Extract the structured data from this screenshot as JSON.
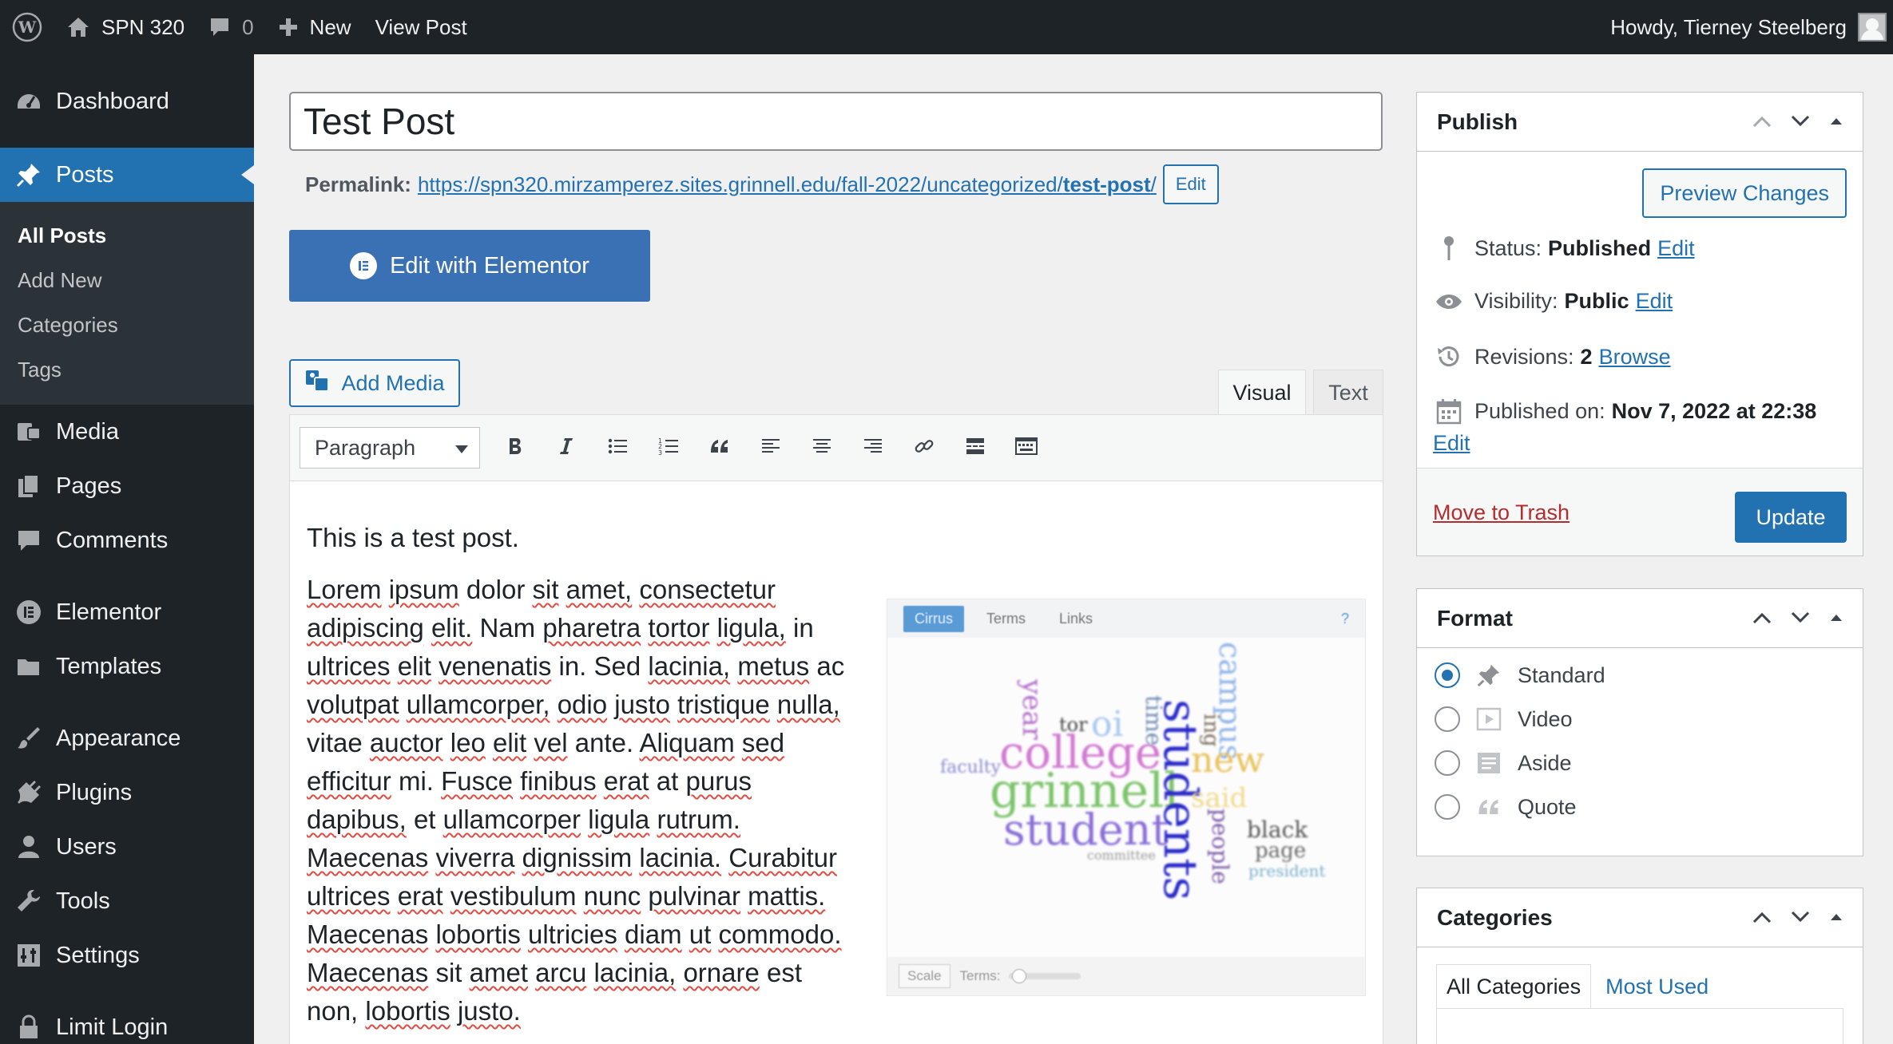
{
  "admin_bar": {
    "site_name": "SPN 320",
    "comments_count": "0",
    "new_label": "New",
    "view_post_label": "View Post",
    "howdy": "Howdy, Tierney Steelberg"
  },
  "sidebar": {
    "items": [
      {
        "label": "Dashboard",
        "icon": "dashboard-icon"
      },
      {
        "label": "Posts",
        "icon": "pin-icon"
      },
      {
        "label": "Media",
        "icon": "media-icon"
      },
      {
        "label": "Pages",
        "icon": "pages-icon"
      },
      {
        "label": "Comments",
        "icon": "comment-icon"
      },
      {
        "label": "Elementor",
        "icon": "elementor-icon"
      },
      {
        "label": "Templates",
        "icon": "folder-icon"
      },
      {
        "label": "Appearance",
        "icon": "brush-icon"
      },
      {
        "label": "Plugins",
        "icon": "plug-icon"
      },
      {
        "label": "Users",
        "icon": "user-icon"
      },
      {
        "label": "Tools",
        "icon": "wrench-icon"
      },
      {
        "label": "Settings",
        "icon": "settings-icon"
      },
      {
        "label": "Limit Login",
        "icon": "lock-icon"
      }
    ],
    "posts_submenu": [
      "All Posts",
      "Add New",
      "Categories",
      "Tags"
    ]
  },
  "editor": {
    "title": "Test Post",
    "permalink_label": "Permalink:",
    "permalink_base": "https://spn320.mirzamperez.sites.grinnell.edu/fall-2022/uncategorized/",
    "permalink_slug": "test-post",
    "permalink_trailing": "/",
    "permalink_edit": "Edit",
    "elementor_button": "Edit with Elementor",
    "add_media": "Add Media",
    "tab_visual": "Visual",
    "tab_text": "Text",
    "format_select": "Paragraph",
    "intro": "This is a test post.",
    "body": "Lorem ipsum dolor sit amet, consectetur adipiscing elit. Nam pharetra tortor ligula, in ultrices elit venenatis in. Sed lacinia, metus ac volutpat ullamcorper, odio justo tristique nulla, vitae auctor leo elit vel ante. Aliquam sed efficitur mi. Fusce finibus erat at purus dapibus, et ullamcorper ligula rutrum. Maecenas viverra dignissim lacinia. Curabitur ultrices erat vestibulum nunc pulvinar mattis. Maecenas lobortis ultricies diam ut commodo. Maecenas sit amet arcu lacinia, ornare est non, lobortis justo.",
    "spell_flagged": [
      "Lorem",
      "ipsum",
      "amet,",
      "consectetur",
      "adipiscing",
      "elit.",
      "pharetra",
      "tortor",
      "ligula,",
      "ultrices",
      "elit",
      "venenatis",
      "lacinia,",
      "metus",
      "volutpat",
      "ullamcorper,",
      "odio",
      "justo",
      "tristique",
      "nulla,",
      "auctor",
      "leo",
      "elit",
      "vel",
      "Aliquam",
      "sed",
      "efficitur",
      "Fusce",
      "finibus",
      "erat",
      "purus",
      "dapibus,",
      "ullamcorper",
      "ligula",
      "rutrum.",
      "Maecenas",
      "viverra",
      "dignissim",
      "lacinia.",
      "Curabitur",
      "ultrices",
      "erat",
      "vestibulum",
      "nunc",
      "pulvinar",
      "mattis.",
      "Maecenas",
      "lobortis",
      "ultricies",
      "diam",
      "ut",
      "commodo.",
      "Maecenas",
      "sit",
      "amet",
      "arcu",
      "lacinia,",
      "ornare",
      "lobortis",
      "justo."
    ]
  },
  "word_cloud": {
    "tabs": [
      "Cirrus",
      "Terms",
      "Links"
    ],
    "help": "?",
    "scale_label": "Scale",
    "terms_label": "Terms:",
    "words": [
      {
        "text": "college",
        "color": "#d17ad1"
      },
      {
        "text": "grinnell",
        "color": "#7cc46b"
      },
      {
        "text": "student",
        "color": "#8a6fd6"
      },
      {
        "text": "students",
        "color": "#2b2bc9"
      },
      {
        "text": "campus",
        "color": "#8fb4e8"
      },
      {
        "text": "new",
        "color": "#e8c25a"
      },
      {
        "text": "year",
        "color": "#b46fc9"
      },
      {
        "text": "oi",
        "color": "#a8c8f0"
      },
      {
        "text": "time",
        "color": "#6f8ab3"
      },
      {
        "text": "said",
        "color": "#f2d98a"
      },
      {
        "text": "black",
        "color": "#555555"
      },
      {
        "text": "page",
        "color": "#6a6a6a"
      },
      {
        "text": "people",
        "color": "#7b5aa6"
      },
      {
        "text": "faculty",
        "color": "#8a8ad0"
      },
      {
        "text": "president",
        "color": "#7ab0cc"
      },
      {
        "text": "tor",
        "color": "#444444"
      },
      {
        "text": "ing",
        "color": "#7a6a5a"
      },
      {
        "text": "committee",
        "color": "#9a9a9a"
      }
    ]
  },
  "publish": {
    "title": "Publish",
    "preview_button": "Preview Changes",
    "status_label": "Status:",
    "status_value": "Published",
    "visibility_label": "Visibility:",
    "visibility_value": "Public",
    "revisions_label": "Revisions:",
    "revisions_value": "2",
    "browse": "Browse",
    "published_label": "Published on:",
    "published_value": "Nov 7, 2022 at 22:38",
    "edit": "Edit",
    "trash": "Move to Trash",
    "update": "Update"
  },
  "format_box": {
    "title": "Format",
    "options": [
      {
        "label": "Standard",
        "checked": true
      },
      {
        "label": "Video",
        "checked": false
      },
      {
        "label": "Aside",
        "checked": false
      },
      {
        "label": "Quote",
        "checked": false
      }
    ]
  },
  "categories_box": {
    "title": "Categories",
    "tab_all": "All Categories",
    "tab_used": "Most Used"
  },
  "colors": {
    "admin_dark": "#1d2327",
    "accent": "#2271b1",
    "elementor": "#3a71b4",
    "trash": "#b32d2e"
  }
}
